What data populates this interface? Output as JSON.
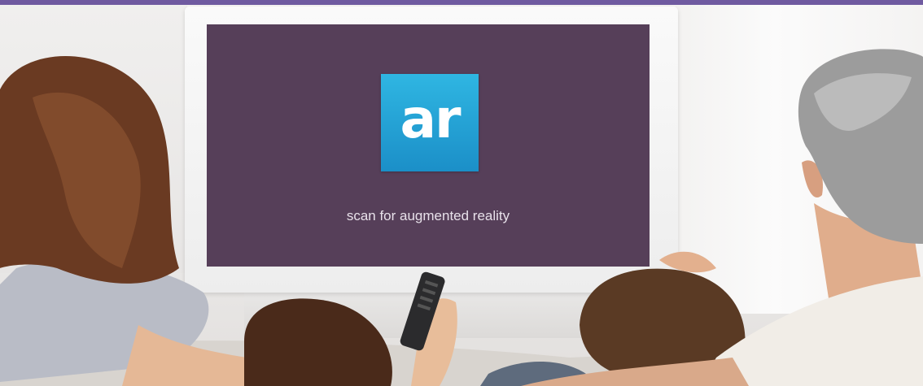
{
  "colors": {
    "top_band": "#6f5aa0",
    "tv_screen": "#563f59",
    "ar_logo_top": "#2fb6e2",
    "ar_logo_bottom": "#1b8fc8"
  },
  "tv": {
    "logo_text": "ar",
    "caption": "scan for augmented reality"
  }
}
